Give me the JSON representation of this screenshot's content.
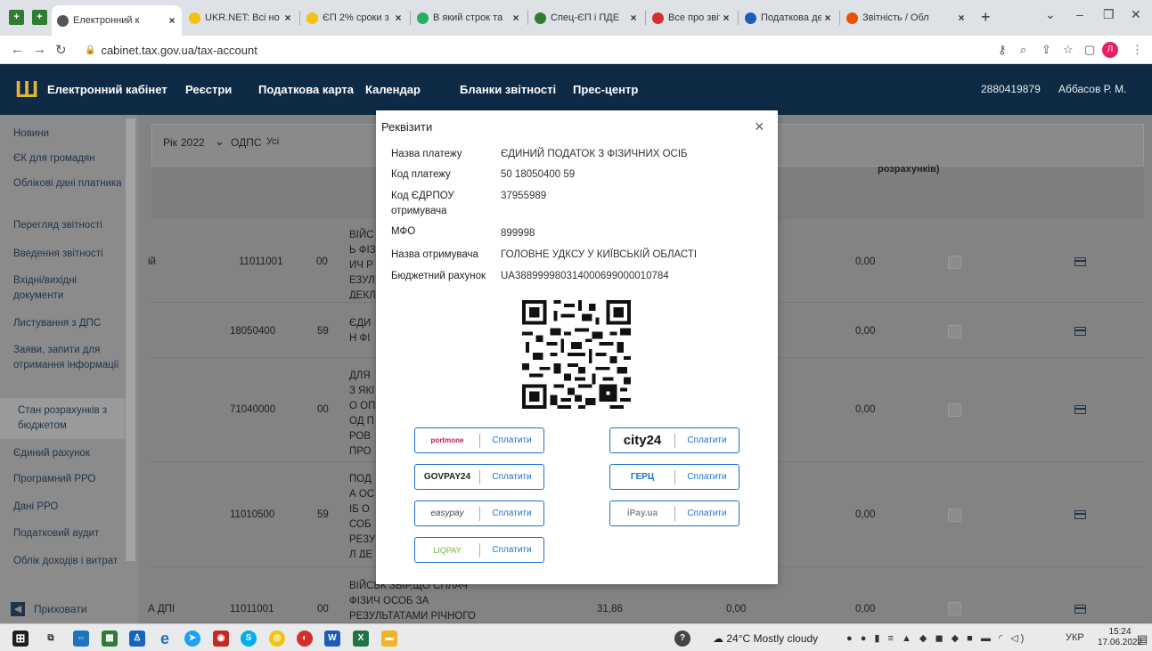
{
  "browser": {
    "tabs": [
      {
        "title": "Електронний к",
        "color": "#555555"
      },
      {
        "title": "UKR.NET: Всі но",
        "color": "#f4c20d"
      },
      {
        "title": "ЄП 2% сроки з",
        "color": "#f4c20d"
      },
      {
        "title": "В який строк та",
        "color": "#27ae60"
      },
      {
        "title": "Спец-ЄП і ПДЕ",
        "color": "#2e7d32"
      },
      {
        "title": "Все про звітнісі",
        "color": "#d32f2f"
      },
      {
        "title": "Податкова дек",
        "color": "#1e5bb8"
      },
      {
        "title": "Звітність / Обл",
        "color": "#e65100"
      }
    ],
    "url": "cabinet.tax.gov.ua/tax-account",
    "profile_initial": "Л"
  },
  "header": {
    "site_name": "Електронний кабінет",
    "nav": [
      "Реєстри",
      "Податкова карта",
      "Календар",
      "Бланки звітності",
      "Прес-центр"
    ],
    "taxpayer_id": "2880419879",
    "user_name": "Аббасов Р. М."
  },
  "sidebar": {
    "items": [
      {
        "label": "Новини"
      },
      {
        "label": "ЄК для громадян"
      },
      {
        "label": "Облікові дані платника"
      },
      {
        "label": "Перегляд звітності"
      },
      {
        "label": "Введення звітності"
      },
      {
        "label": "Вхідні/вихідні документи"
      },
      {
        "label": "Листування з ДПС"
      },
      {
        "label": "Заяви, запити для отримання інформації"
      },
      {
        "label": "Стан розрахунків з бюджетом"
      },
      {
        "label": "Єдиний рахунок"
      },
      {
        "label": "Програмний РРО"
      },
      {
        "label": "Дані РРО"
      },
      {
        "label": "Податковий аудит"
      },
      {
        "label": "Облік доходів і витрат"
      }
    ],
    "hide_label": "Приховати"
  },
  "filters": {
    "year_label": "Рік",
    "year_value": "2022",
    "odps_label": "ОДПС",
    "odps_value": "Усі"
  },
  "table": {
    "header_fragment": "розрахунків)",
    "rows": [
      {
        "name_frag": "ій",
        "code": "11011001",
        "sub": "00",
        "desc": "ВІЙСЬ ФІЗИЧ РЕЗУЛ ДЕКЛ",
        "amount": "",
        "amount2": "",
        "balance": "0,00"
      },
      {
        "name_frag": "",
        "code": "18050400",
        "sub": "59",
        "desc": "ЄДИН ФІЗИЧ",
        "amount": "",
        "amount2": "",
        "balance": "0,00"
      },
      {
        "name_frag": "",
        "code": "71040000",
        "sub": "00",
        "desc": "ДЛЯ З ЯКІ О ОПОД ПРОВ ПРОФ",
        "amount": "",
        "amount2": "",
        "balance": "0,00"
      },
      {
        "name_frag": "",
        "code": "11010500",
        "sub": "59",
        "desc": "ПОДА ОСІБ ОСОБ РЕЗУЛ ДЕКЛ",
        "amount": "",
        "amount2": "",
        "balance": "0,00"
      },
      {
        "name_frag": "А ДПІ",
        "code": "11011001",
        "sub": "00",
        "desc": "ВІЙСЬК ЗБІР,ЩО СПЛАЧ ФІЗИЧ ОСОБ ЗА РЕЗУЛЬТАТАМИ РІЧНОГО",
        "amount": "31,86",
        "amount2": "0,00",
        "balance": "0,00"
      }
    ]
  },
  "modal": {
    "title": "Реквізити",
    "fields": [
      {
        "label": "Назва платежу",
        "value": "ЄДИНИЙ ПОДАТОК З ФІЗИЧНИХ ОСІБ"
      },
      {
        "label": "Код платежу",
        "value": "50 18050400 59"
      },
      {
        "label": "Код ЄДРПОУ отримувача",
        "value": "37955989"
      },
      {
        "label": "МФО",
        "value": "899998"
      },
      {
        "label": "Назва отримувача",
        "value": "ГОЛОВНЕ УДКСУ У КИЇВСЬКІЙ ОБЛАСТІ"
      },
      {
        "label": "Бюджетний рахунок",
        "value": "UA388999980314000699000010784"
      }
    ],
    "pay_label": "Сплатити",
    "providers": [
      {
        "name": "portmone",
        "color": "#c2185b"
      },
      {
        "name": "city24",
        "color": "#111111"
      },
      {
        "name": "GOVPAY24",
        "color": "#222222"
      },
      {
        "name": "ГЕРЦ",
        "color": "#1d6fd1"
      },
      {
        "name": "easypay",
        "color": "#444444"
      },
      {
        "name": "iPay.ua",
        "color": "#888888"
      },
      {
        "name": "LIQPAY",
        "color": "#6db33f"
      }
    ]
  },
  "taskbar": {
    "weather": "24°C Mostly cloudy",
    "lang": "УКР",
    "time": "15:24",
    "date": "17.06.2022"
  }
}
